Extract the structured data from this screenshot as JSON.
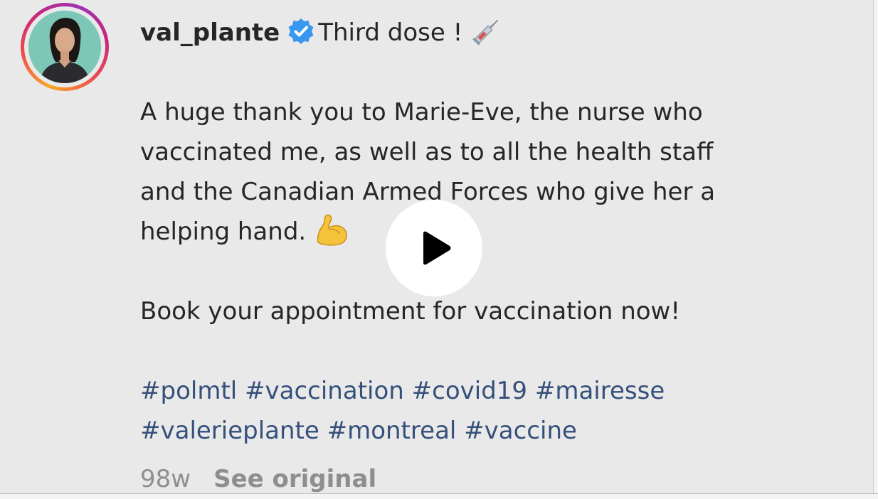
{
  "post": {
    "username": "val_plante",
    "verified_icon": "verified-badge-icon",
    "title_text": "Third dose !",
    "title_emoji": "syringe-icon",
    "body_lines": [
      "A huge thank you to Marie-Eve, the nurse who",
      "vaccinated me, as well as to all the health staff",
      "and the Canadian Armed Forces who give her a",
      "helping hand."
    ],
    "body_emoji": "flexed-biceps-icon",
    "cta": "Book your appointment for vaccination now!",
    "hashtags_line1": [
      "#polmtl",
      "#vaccination",
      "#covid19",
      "#mairesse"
    ],
    "hashtags_line2": [
      "#valerieplante",
      "#montreal",
      "#vaccine"
    ],
    "time_ago": "98w",
    "see_original": "See original"
  },
  "video": {
    "play_icon": "play-icon"
  },
  "colors": {
    "background": "#e9e9e9",
    "text": "#262626",
    "hashtag": "#35507a",
    "meta": "#8e8e8e",
    "verified": "#3897f0"
  }
}
